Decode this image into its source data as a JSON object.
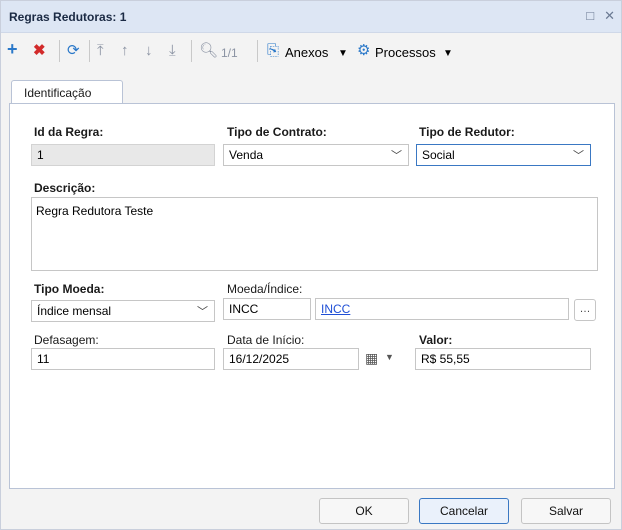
{
  "window": {
    "title": "Regras Redutoras: 1"
  },
  "toolbar": {
    "record_counter": "1/1",
    "attachments_label": "Anexos",
    "processes_label": "Processos"
  },
  "tabs": [
    {
      "label": "Identificação"
    }
  ],
  "form": {
    "rule_id": {
      "label": "Id da Regra:",
      "value": "1"
    },
    "contract_type": {
      "label": "Tipo de Contrato:",
      "value": "Venda"
    },
    "reducer_type": {
      "label": "Tipo de Redutor:",
      "value": "Social"
    },
    "description": {
      "label": "Descrição:",
      "value": "Regra Redutora Teste"
    },
    "currency_type": {
      "label": "Tipo Moeda:",
      "value": "Índice mensal"
    },
    "currency_index": {
      "label": "Moeda/Índice:",
      "code": "INCC",
      "link": "INCC"
    },
    "lag": {
      "label": "Defasagem:",
      "value": "11"
    },
    "start_date": {
      "label": "Data de Início:",
      "value": "16/12/2025"
    },
    "amount": {
      "label": "Valor:",
      "value": "R$ 55,55"
    }
  },
  "footer": {
    "ok_label": "OK",
    "cancel_label": "Cancelar",
    "save_label": "Salvar"
  },
  "colors": {
    "titlebar": "#dde6f4",
    "add": "#2a78c9",
    "delete": "#d22a2a",
    "link": "#1f4fd6"
  }
}
